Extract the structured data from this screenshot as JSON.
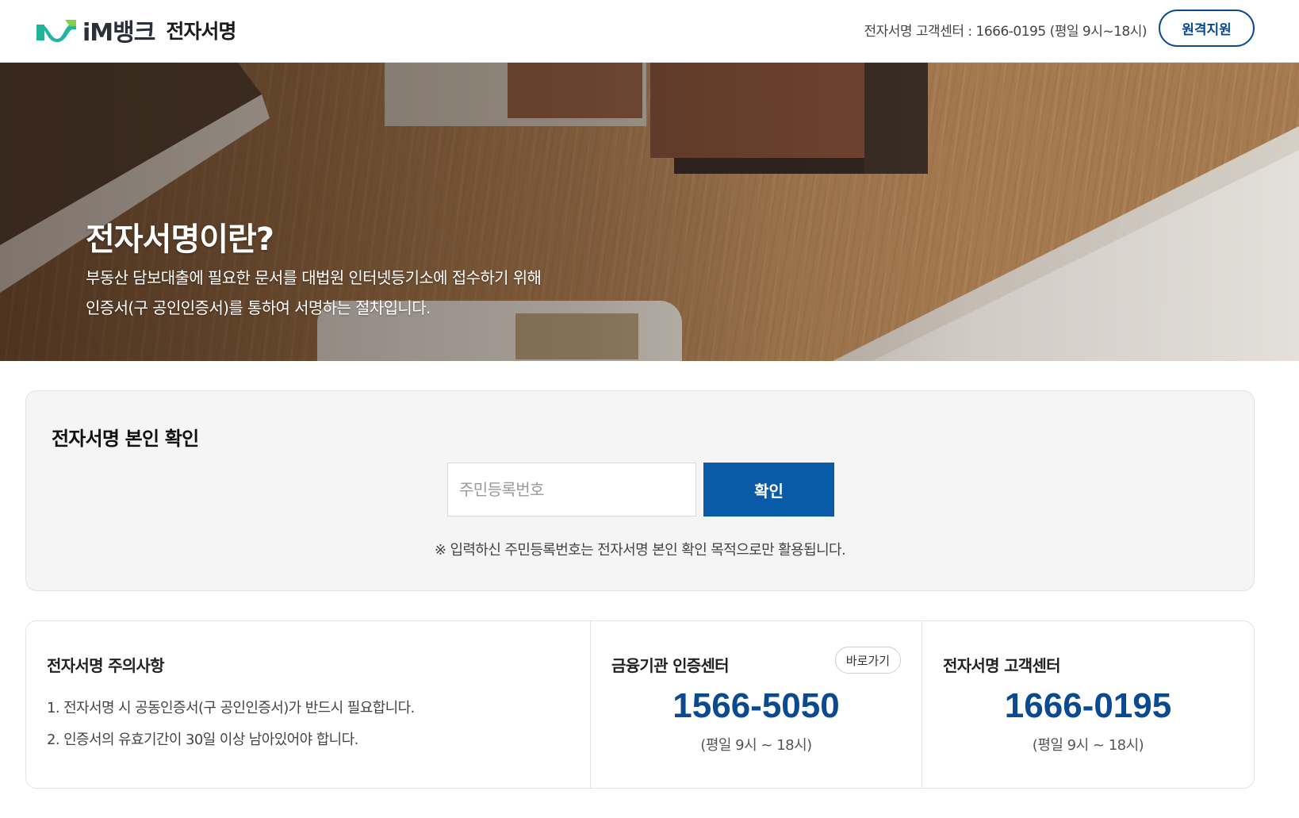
{
  "header": {
    "brand": "iM뱅크",
    "service_name": "전자서명",
    "cs_info": "전자서명 고객센터 : 1666-0195 (평일 9시~18시)",
    "remote_support_label": "원격지원"
  },
  "hero": {
    "title": "전자서명이란?",
    "desc_line1": "부동산 담보대출에 필요한 문서를 대법원 인터넷등기소에 접수하기 위해",
    "desc_line2": "인증서(구 공인인증서)를 통하여 서명하는 절차입니다."
  },
  "verify": {
    "title": "전자서명 본인 확인",
    "input_placeholder": "주민등록번호",
    "input_value": "",
    "confirm_label": "확인",
    "note": "※ 입력하신 주민등록번호는 전자서명 본인 확인 목적으로만 활용됩니다."
  },
  "notice": {
    "title": "전자서명 주의사항",
    "items": [
      "1. 전자서명 시 공동인증서(구 공인인증서)가 반드시 필요합니다.",
      "2. 인증서의 유효기간이 30일 이상 남아있어야 합니다."
    ]
  },
  "fin_center": {
    "title": "금융기관 인증센터",
    "shortcut_label": "바로가기",
    "phone": "1566-5050",
    "hours": "(평일 9시 ~ 18시)"
  },
  "cs_center": {
    "title": "전자서명 고객센터",
    "phone": "1666-0195",
    "hours": "(평일 9시 ~ 18시)"
  },
  "colors": {
    "brand_green": "#1fb39a",
    "brand_navy": "#0b4a8f",
    "button_blue": "#0a5ba7"
  },
  "icons": {
    "logo": "im-logo-icon"
  }
}
